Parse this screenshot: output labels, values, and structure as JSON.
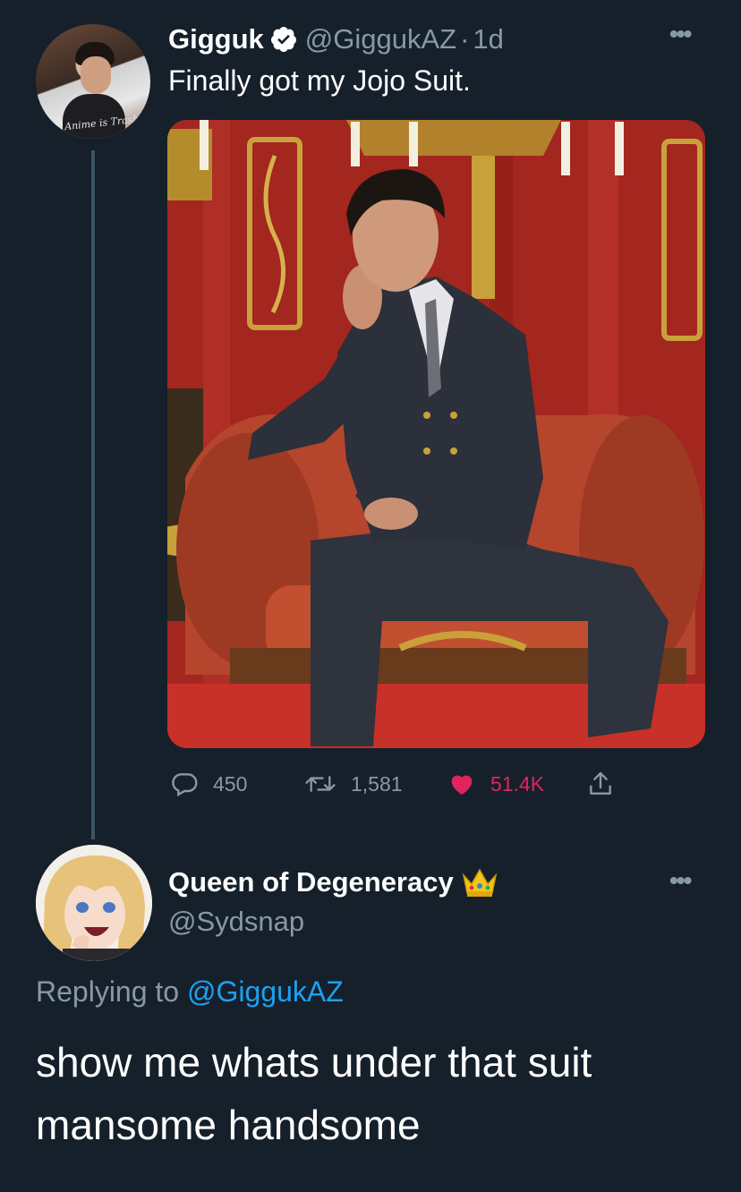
{
  "tweet": {
    "author_name": "Gigguk",
    "author_handle": "@GiggukAZ",
    "separator": "·",
    "time": "1d",
    "text": "Finally got my Jojo Suit.",
    "avatar_shirt_text": "Anime is Trash",
    "verified": true,
    "stats": {
      "replies": "450",
      "retweets": "1,581",
      "likes": "51.4K"
    },
    "liked": true
  },
  "reply": {
    "author_name": "Queen of Degeneracy",
    "author_emoji": "crown",
    "author_handle": "@Sydsnap",
    "replying_prefix": "Replying to",
    "replying_to": "@GiggukAZ",
    "text": "show me whats under that suit mansome handsome"
  },
  "icons": {
    "more": "more-icon",
    "reply": "comment-icon",
    "retweet": "retweet-icon",
    "like": "heart-icon",
    "share": "share-icon",
    "verified": "verified-badge-icon"
  },
  "colors": {
    "background": "#15202b",
    "secondary_text": "#8899a6",
    "link": "#1da1f2",
    "like": "#e0245e",
    "thread_line": "#3d5466"
  }
}
